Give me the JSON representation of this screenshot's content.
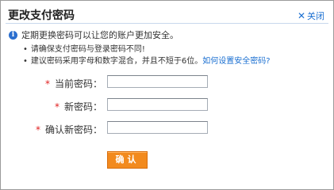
{
  "dialog": {
    "title": "更改支付密码",
    "close_label": "关闭"
  },
  "notice": {
    "headline": "定期更换密码可以让您的账户更加安全。",
    "tips": [
      "请确保支付密码与登录密码不同!",
      "建议密码采用字母和数字混合，并且不短于6位。"
    ],
    "help_link": "如何设置安全密码?"
  },
  "form": {
    "required_mark": "*",
    "current_password_label": "当前密码：",
    "current_password_value": "",
    "new_password_label": "新密码：",
    "new_password_value": "",
    "confirm_password_label": "确认新密码：",
    "confirm_password_value": "",
    "submit_label": "确认"
  },
  "colors": {
    "accent_link": "#1a6fd1",
    "required": "#e02020",
    "button": "#f28a1e"
  },
  "icons": [
    "info-icon",
    "close-icon"
  ]
}
